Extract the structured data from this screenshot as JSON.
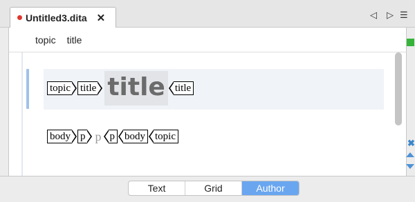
{
  "tab": {
    "name": "Untitled3.dita",
    "close": "✕",
    "modified_color": "#e0372c"
  },
  "tab_nav": {
    "left": "◁",
    "right": "▷",
    "menu": "☰"
  },
  "breadcrumb": [
    "topic",
    "title"
  ],
  "editor": {
    "line1": {
      "open_topic": "topic",
      "open_title": "title",
      "title_text": "title",
      "close_title": "title"
    },
    "line2": {
      "open_body": "body",
      "open_p": "p",
      "p_text": "p",
      "close_p": "p",
      "close_body": "body",
      "close_topic": "topic"
    }
  },
  "side": {
    "x_icon": "✖",
    "status_color": "#36b43a"
  },
  "modes": {
    "items": [
      "Text",
      "Grid",
      "Author"
    ],
    "active": "Author"
  }
}
